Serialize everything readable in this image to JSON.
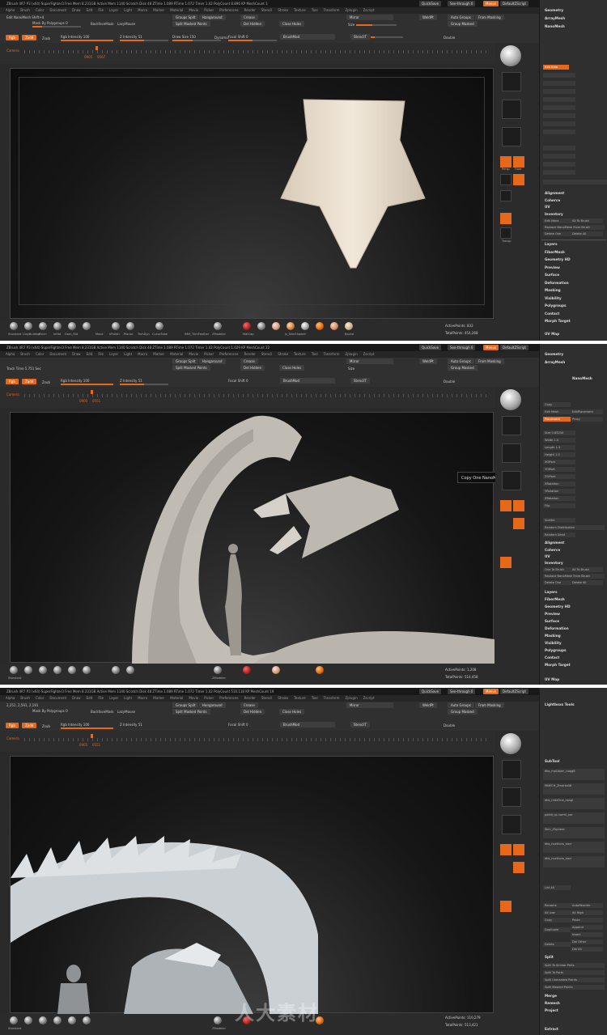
{
  "panels": [
    {
      "title": "ZBrush 4R7 P3 (x64)  SuperFighter3  Free Mem 8.231GB  Active Mem 1140  Scratch Disk 48  ZTime 1.089  RTime 1.072  Timer 1.02  PolyCount 8.896 KP  MeshCount 1",
      "mode_label": "Edit NanoMesh  Shift+4",
      "active_points": "ActivePoints: 832",
      "total_points": "TotalPoints: 454,268",
      "ruler_num": "0905",
      "ruler_num2": "0567"
    },
    {
      "title": "ZBrush 4R7 P3 (x64)  SuperFighter3  Free Mem 8.231GB  Active Mem 1140  Scratch Disk 48  ZTime 1.089  RTime 1.072  Timer 1.02  PolyCount 1.029 KP  MeshCount 22",
      "mode_label": "Track Time 5.751 Sec",
      "active_points": "ActivePoints: 1,208",
      "total_points": "TotalPoints: 514,458",
      "ruler_num": "0905",
      "ruler_num2": "0551",
      "tooltip": "Copy One NanoMesh To Mesh"
    },
    {
      "title": "ZBrush 4R7 P3 (x64)  SuperFighter3  Free Mem 8.231GB  Active Mem 1140  Scratch Disk 48  ZTime 1.089  RTime 1.072  Timer 1.02  PolyCount 510.118 KP  MeshCount 19",
      "mode_label": "2,251, 2,591, 2,191",
      "active_points": "ActivePoints: 110,279",
      "total_points": "TotalPoints: 513,421",
      "ruler_num": "0905",
      "ruler_num2": "0551"
    }
  ],
  "titlebar": {
    "quicksave": "QuickSave",
    "seethrough": "See-through 0",
    "menus": "Menus",
    "defaultscript": "DefaultZScript"
  },
  "menubar": [
    "Alpha",
    "Brush",
    "Color",
    "Document",
    "Draw",
    "Edit",
    "File",
    "Layer",
    "Light",
    "Macro",
    "Marker",
    "Material",
    "Movie",
    "Picker",
    "Preferences",
    "Render",
    "Stencil",
    "Stroke",
    "Texture",
    "Tool",
    "Transform",
    "Zplugin",
    "Zscript"
  ],
  "toolbar": {
    "mask_polygroups": "Mask By Polygroups 0",
    "backface": "BackfaceMask",
    "lazymouse": "LazyMouse",
    "groups_split": "Groups Split",
    "hangaround": "Hangaround",
    "split_masked": "Split Masked Points",
    "crease": "Crease",
    "del_hidden": "Del Hidden",
    "close_holes": "Close Holes",
    "mirror": "Mirror",
    "size": "Size",
    "weld": "WeldPt",
    "auto_groups": "Auto Groups",
    "from_masking": "From Masking",
    "group_masked": "Group Masked",
    "rgb": "Rgb",
    "zadd": "Zadd",
    "zsub": "Zsub",
    "rgb_intensity": "Rgb Intensity 100",
    "z_intensity": "Z Intensity 51",
    "draw_size": "Draw Size 150",
    "dynamic": "Dynamic",
    "focal_shift": "Focal Shift 0",
    "brushmod": "BrushMod",
    "stencil": "StencilT",
    "double": "Double",
    "camera": "Camera"
  },
  "shelf": {
    "brushes": [
      "Standard",
      "ClayBuildup",
      "Pinch",
      "Inflat",
      "Dam_Std",
      "Move Tp",
      "Move",
      "hPolish",
      "Planar",
      "TrimDyn",
      "CurveTube",
      "IMM BPR",
      "IMM_TrimFeather",
      "ZModeler"
    ],
    "materials": [
      "MatCap",
      "Tlgr",
      "MatCap_Gel",
      "js_SkinShade4",
      "BasicMat",
      "Dots",
      "SmoothFlat",
      "Dots",
      "Backd"
    ]
  },
  "right_shelf": [
    "Persp",
    "Floor",
    "Local",
    "L.Sym",
    "Frame",
    "Move",
    "Scale",
    "Rotate",
    "Line Fill",
    "PolyF",
    "Transp",
    "Solo",
    "Ghost"
  ],
  "tray1": {
    "headers": [
      "Geometry",
      "ArrayMesh",
      "NanoMesh",
      "Layers",
      "FiberMesh",
      "Geometry HD",
      "Preview",
      "Surface",
      "Deformation",
      "Masking",
      "Visibility",
      "Polygroups",
      "Contact",
      "Morph Target",
      "UV Map"
    ],
    "items": [
      "Edit Item",
      "Alignment",
      "Coherce",
      "UV",
      "Inventory",
      "Edit Nano",
      "All To Brush",
      "Replace NanoMesh From Brush",
      "Delete One",
      "Delete All"
    ]
  },
  "tray2": {
    "headers": [
      "Geometry",
      "ArrayMesh",
      "NanoMesh",
      "Layers",
      "FiberMesh",
      "Geometry HD",
      "Preview",
      "Surface",
      "Deformation",
      "Masking",
      "Visibility",
      "Polygroups",
      "Contact",
      "Morph Target",
      "UV Map"
    ],
    "items": [
      "Copy",
      "Edit Mesh",
      "EditPlacement",
      "Placement",
      "Proxy",
      "Size 0.83234",
      "Width 1.0",
      "Length 1.5",
      "Height 1.0",
      "XOffset",
      "YOffset",
      "ZOffset",
      "XRotation",
      "YRotation",
      "ZRotation",
      "Flip",
      "Scatter",
      "Random Distribution",
      "Random Seed",
      "Alignment",
      "Coherce",
      "UV",
      "Inventory",
      "One To Brush",
      "All To Brush",
      "Replace NanoMesh From Brush",
      "Delete One",
      "Delete All"
    ]
  },
  "tray3": {
    "header": "Lightboxs Tools",
    "subtool": "SubTool",
    "items": [
      "dbs_mpUqlon_nogg8",
      "MNECH_Zmarks08",
      "dbs_rndaOne_nosgl",
      "polidi_rp.norml_nor",
      "Skin_ZSphere",
      "dbs_nocthors_nocr",
      "dbs_nocthors_nocr"
    ],
    "list_all": "List All",
    "actions": [
      "Rename",
      "AutoReorder",
      "All Low",
      "All High",
      "Copy",
      "Paste",
      "Duplicate",
      "Append",
      "Insert",
      "Delete",
      "Del Other",
      "Del All"
    ],
    "split": "Split",
    "split_items": [
      "Split To Similar Parts",
      "Split To Parts",
      "Split Unmasked Points",
      "Split Masked Points"
    ],
    "more": [
      "Merge",
      "Remesh",
      "Project",
      "Extract"
    ]
  },
  "watermark": "人大素材"
}
